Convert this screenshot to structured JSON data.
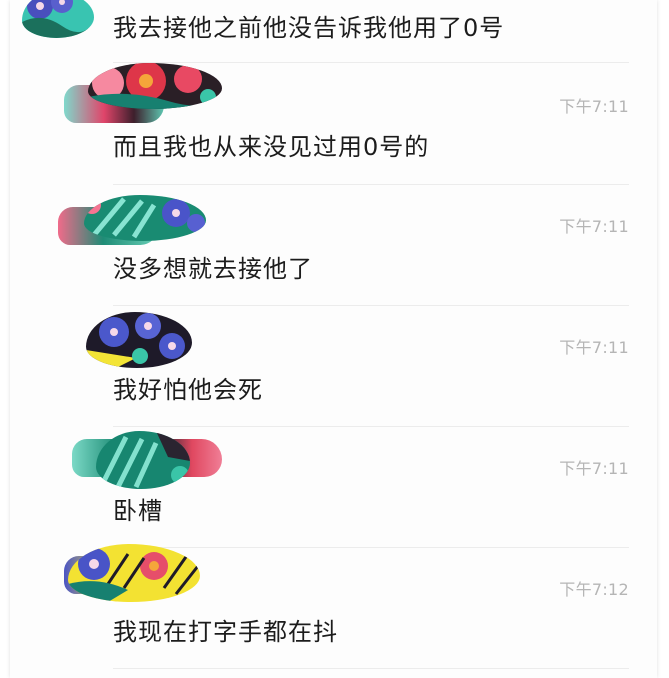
{
  "messages": [
    {
      "time": "",
      "text": "我去接他之前他没告诉我他用了0号"
    },
    {
      "time": "下午7:11",
      "text": "而且我也从来没见过用0号的"
    },
    {
      "time": "下午7:11",
      "text": "没多想就去接他了"
    },
    {
      "time": "下午7:11",
      "text": "我好怕他会死"
    },
    {
      "time": "下午7:11",
      "text": "卧槽"
    },
    {
      "time": "下午7:12",
      "text": "我现在打字手都在抖"
    }
  ],
  "colors": {
    "text": "#1c1c1c",
    "time": "#b5b5b5",
    "divider": "#ececec"
  },
  "icons": [
    "floral-avatar-icon",
    "name-redaction-smudge"
  ]
}
